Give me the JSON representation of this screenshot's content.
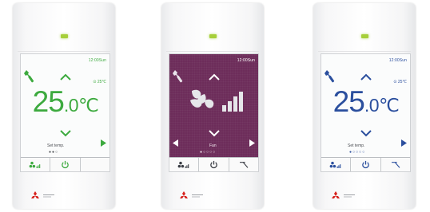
{
  "colors": {
    "green": "#3daa3f",
    "blue": "#2b4f9e",
    "purple_screen": "#6d2d5a",
    "led": "#a6cf3a",
    "icon_dark": "#3a3d44"
  },
  "icons": {
    "wrench": "wrench-icon",
    "up": "chevron-up-icon",
    "down": "chevron-down-icon",
    "next": "arrow-right-icon",
    "prev": "arrow-left-icon",
    "mode": "fan-speed-icon",
    "power": "power-icon",
    "menu": "return-icon",
    "brand": "three-diamond-logo"
  },
  "remote1": {
    "time": "12:00Sun",
    "room_temp": "⊙ 25℃",
    "temp_main": "25",
    "temp_decimal": ".0℃",
    "set_temp": "Set temp.",
    "page_dots": "●●○"
  },
  "remote2": {
    "time": "12:00Sun",
    "fan_label": "Fan",
    "page_dots": "●○○○○"
  },
  "remote3": {
    "time": "12:00Sun",
    "room_temp": "⊙ 25℃",
    "temp_main": "25",
    "temp_decimal": ".0℃",
    "set_temp": "Set temp.",
    "page_dots": "●○○○○"
  }
}
